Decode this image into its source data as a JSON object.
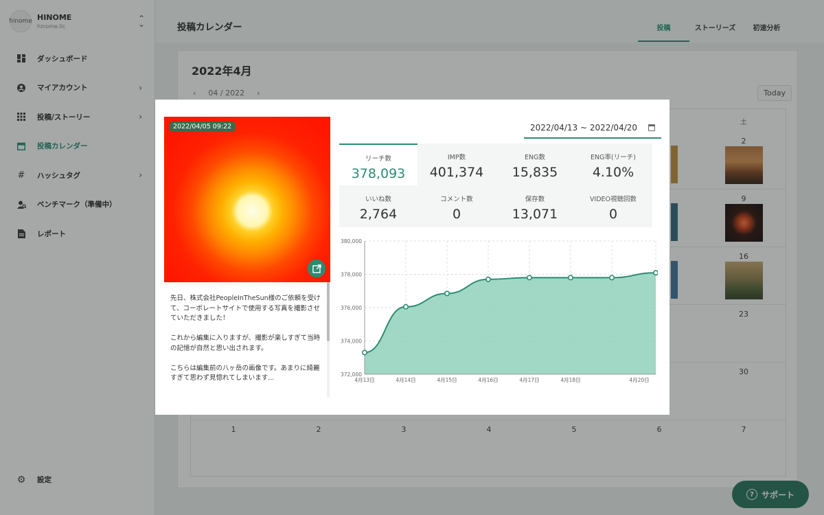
{
  "brand": {
    "name": "HINOME",
    "sub": "hinome.llc",
    "logo_text": "hinome"
  },
  "sidebar": {
    "items": [
      {
        "label": "ダッシュボード",
        "icon": "dashboard-icon"
      },
      {
        "label": "マイアカウント",
        "icon": "account-icon"
      },
      {
        "label": "投稿/ストーリー",
        "icon": "grid-icon"
      },
      {
        "label": "投稿カレンダー",
        "icon": "calendar-icon"
      },
      {
        "label": "ハッシュタグ",
        "icon": "hashtag-icon"
      },
      {
        "label": "ベンチマーク（準備中）",
        "icon": "benchmark-icon"
      },
      {
        "label": "レポート",
        "icon": "report-icon"
      }
    ],
    "settings_label": "設定"
  },
  "header": {
    "title": "投稿カレンダー",
    "tabs": [
      {
        "label": "投稿"
      },
      {
        "label": "ストーリーズ"
      },
      {
        "label": "初速分析"
      }
    ]
  },
  "calendar": {
    "title": "2022年4月",
    "month_label": "04 / 2022",
    "prev": "‹",
    "next": "›",
    "today_label": "Today",
    "weekday_sat": "土",
    "days": [
      "2",
      "9",
      "16",
      "23",
      "30"
    ],
    "next_month_days": [
      "1",
      "2",
      "3",
      "4",
      "5",
      "6",
      "7"
    ]
  },
  "modal": {
    "post_date": "2022/04/05 09:22",
    "caption": "先日、株式会社PeopleInTheSun様のご依頼を受けて、コーポレートサイトで使用する写真を撮影させていただきました！\n\nこれから編集に入りますが、撮影が楽しすぎて当時の記憶が自然と思い出されます。\n\nこちらは編集前の八ヶ岳の画像です。あまりに綺麗すぎて思わず見惚れてしまいます...",
    "date_range": "2022/04/13 ~ 2022/04/20",
    "metrics": [
      {
        "label": "リーチ数",
        "value": "378,093"
      },
      {
        "label": "IMP数",
        "value": "401,374"
      },
      {
        "label": "ENG数",
        "value": "15,835"
      },
      {
        "label": "ENG率(リーチ)",
        "value": "4.10%"
      },
      {
        "label": "いいね数",
        "value": "2,764"
      },
      {
        "label": "コメント数",
        "value": "0"
      },
      {
        "label": "保存数",
        "value": "13,071"
      },
      {
        "label": "VIDEO視聴回数",
        "value": "0"
      }
    ]
  },
  "chart_data": {
    "type": "area",
    "x": [
      "4月13日",
      "4月14日",
      "4月15日",
      "4月16日",
      "4月17日",
      "4月18日",
      "4月19日",
      "4月20日"
    ],
    "x_tick_labels": [
      "4月13日",
      "4月14日",
      "4月15日",
      "4月16日",
      "4月17日",
      "4月18日",
      "4月20日"
    ],
    "values": [
      373300,
      376050,
      376850,
      377700,
      377800,
      377800,
      377800,
      378093
    ],
    "ylim": [
      372000,
      380000
    ],
    "yticks": [
      "372,000",
      "374,000",
      "376,000",
      "378,000",
      "380,000"
    ],
    "grid": true,
    "color": "#2b8b72",
    "fill": "#8fd1bb"
  },
  "support": {
    "label": "サポート"
  }
}
